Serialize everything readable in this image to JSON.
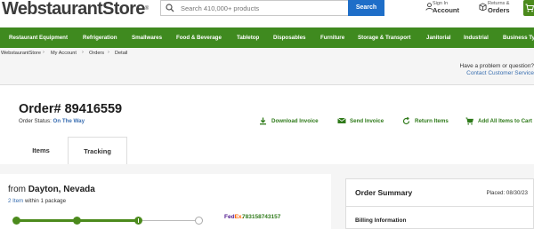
{
  "header": {
    "logo_main": "WebstaurantStore",
    "logo_reg": "®",
    "search_placeholder": "Search 410,000+ products",
    "search_button": "Search",
    "account_small": "Sign In",
    "account_big": "Account",
    "orders_small": "Returns &",
    "orders_big": "Orders"
  },
  "nav": {
    "items": [
      "Restaurant Equipment",
      "Refrigeration",
      "Smallwares",
      "Food & Beverage",
      "Tabletop",
      "Disposables",
      "Furniture",
      "Storage & Transport",
      "Janitorial",
      "Industrial",
      "Business Type"
    ]
  },
  "breadcrumb": [
    "WebstaurantStore",
    "My Account",
    "Orders",
    "Detail"
  ],
  "help": {
    "question": "Have a problem or question?",
    "link": "Contact Customer Service"
  },
  "order": {
    "title": "Order# 89416559",
    "status_label": "Order Status:",
    "status_value": "On The Way",
    "actions": {
      "download": "Download Invoice",
      "send": "Send Invoice",
      "return": "Return Items",
      "add_all": "Add All Items to Cart"
    }
  },
  "tabs": [
    "Items",
    "Tracking"
  ],
  "shipment": {
    "from_label": "from",
    "from_city": "Dayton, Nevada",
    "item_count": "2 Item",
    "package_text": "within 1 package",
    "progress_steps": 4,
    "current_step": 3,
    "carrier_name_1": "Fed",
    "carrier_name_2": "Ex",
    "carrier_suffix": ".",
    "tracking_number": "783158743157"
  },
  "summary": {
    "title": "Order Summary",
    "placed": "Placed: 08/30/23",
    "billing": "Billing Information"
  },
  "colors": {
    "brand_green": "#3f8a1f",
    "search_blue": "#1e6ec8",
    "link_blue": "#3a6fb0"
  }
}
